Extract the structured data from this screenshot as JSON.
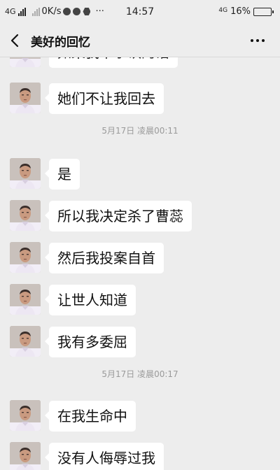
{
  "status_bar": {
    "network": "4G",
    "speed": "0K/s",
    "more": "···",
    "time": "14:57",
    "network_right": "4G",
    "battery": "16%",
    "battery_level": 0.16
  },
  "header": {
    "back_icon": "chevron-left-icon",
    "title": "美好的回忆",
    "more_icon": "more-dots-icon"
  },
  "messages": [
    {
      "text": "如果我不承认的话"
    },
    {
      "text": "她们不让我回去"
    },
    {
      "timestamp": "5月17日 凌晨00:11"
    },
    {
      "text": "是"
    },
    {
      "text": "所以我决定杀了曹蕊"
    },
    {
      "text": "然后我投案自首"
    },
    {
      "text": "让世人知道"
    },
    {
      "text": "我有多委屈"
    },
    {
      "timestamp": "5月17日 凌晨00:17"
    },
    {
      "text": "在我生命中"
    },
    {
      "text": "没有人侮辱过我"
    }
  ]
}
